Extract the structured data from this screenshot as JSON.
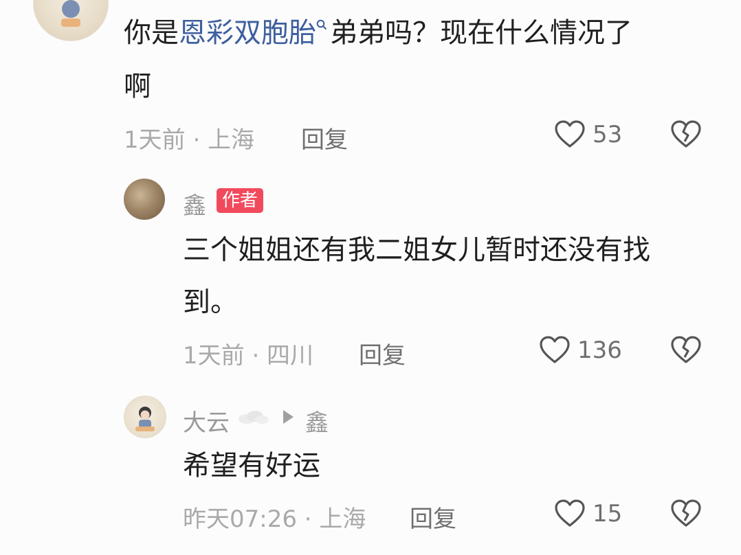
{
  "comment1": {
    "text_before": "你是",
    "highlight": "恩彩双胞胎",
    "text_after": "弟弟吗？现在什么情况了",
    "line2": "啊",
    "meta": "1天前 · 上海",
    "reply_label": "回复",
    "likes": "53"
  },
  "reply1": {
    "author": "鑫",
    "badge": "作者",
    "line1": "三个姐姐还有我二姐女儿暂时还没有找",
    "line2": "到。",
    "meta": "1天前 · 四川",
    "reply_label": "回复",
    "likes": "136"
  },
  "reply2": {
    "author": "大云",
    "reply_to": "鑫",
    "text": "希望有好运",
    "meta": "昨天07:26 · 上海",
    "reply_label": "回复",
    "likes": "15"
  },
  "colors": {
    "link": "#3d5f9f",
    "badge": "#f24a5d"
  },
  "icons": [
    "heart-outline-icon",
    "broken-heart-icon",
    "search-icon",
    "cloud-icon",
    "triangle-right-icon"
  ]
}
